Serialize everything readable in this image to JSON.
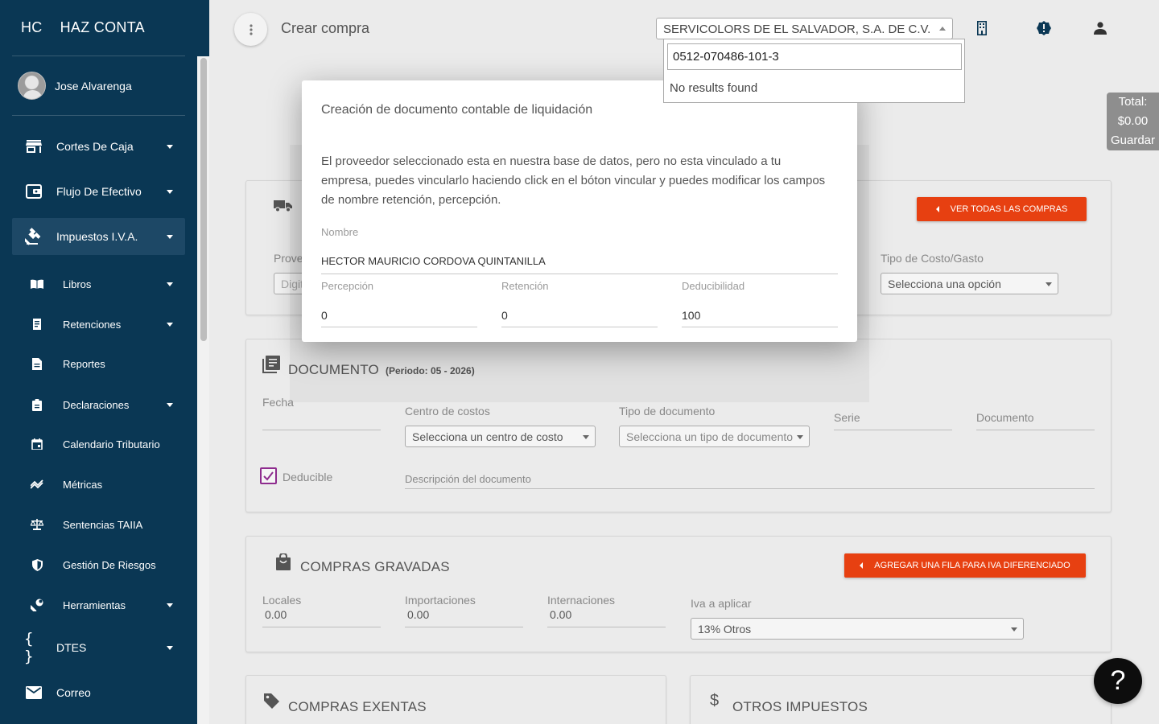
{
  "sidebar": {
    "brand_short": "HC",
    "brand_name": "HAZ CONTA",
    "user_name": "Jose Alvarenga",
    "items": [
      {
        "label": "Cortes De Caja",
        "icon": "store-icon"
      },
      {
        "label": "Flujo De Efectivo",
        "icon": "wallet-icon"
      },
      {
        "label": "Impuestos I.V.A.",
        "icon": "gavel-icon"
      },
      {
        "label": "Libros",
        "icon": "book-icon"
      },
      {
        "label": "Retenciones",
        "icon": "receipt-icon"
      },
      {
        "label": "Reportes",
        "icon": "report-icon"
      },
      {
        "label": "Declaraciones",
        "icon": "clipboard-icon"
      },
      {
        "label": "Calendario Tributario",
        "icon": "calendar-icon"
      },
      {
        "label": "Métricas",
        "icon": "chart-line-icon"
      },
      {
        "label": "Sentencias TAIIA",
        "icon": "scale-icon"
      },
      {
        "label": "Gestión De Riesgos",
        "icon": "shield-icon"
      },
      {
        "label": "Herramientas",
        "icon": "wrench-icon"
      },
      {
        "label": "DTES",
        "icon": "braces-icon"
      },
      {
        "label": "Correo",
        "icon": "mail-icon"
      }
    ]
  },
  "header": {
    "title": "Crear compra",
    "company": "SERVICOLORS DE EL SALVADOR, S.A. DE C.V.",
    "total_label": "Total:",
    "total_value": "$0.00",
    "save_label": "Guardar"
  },
  "dropdown": {
    "search_value": "0512-070486-101-3",
    "no_results": "No results found"
  },
  "provider_card": {
    "button": "VER TODAS LAS COMPRAS",
    "provider_label_partial": "Prove",
    "provider_placeholder_partial": "Digit",
    "cost_type_label": "Tipo de Costo/Gasto",
    "cost_type_value": "Selecciona una opción"
  },
  "document_card": {
    "title": "DOCUMENTO",
    "period": "(Periodo: 05 - 2026)",
    "fecha_label": "Fecha",
    "cost_center_label": "Centro de costos",
    "cost_center_value": "Selecciona un centro de costo",
    "doc_type_label": "Tipo de documento",
    "doc_type_value": "Selecciona un tipo de documento",
    "serie_label": "Serie",
    "documento_label": "Documento",
    "deducible_label": "Deducible",
    "description_label": "Descripción del documento"
  },
  "gravadas_card": {
    "title": "COMPRAS GRAVADAS",
    "button": "AGREGAR UNA FILA PARA IVA DIFERENCIADO",
    "locales_label": "Locales",
    "locales_value": "0.00",
    "importaciones_label": "Importaciones",
    "importaciones_value": "0.00",
    "internaciones_label": "Internaciones",
    "internaciones_value": "0.00",
    "iva_label": "Iva a aplicar",
    "iva_value": "13% Otros"
  },
  "exentas_card": {
    "title": "COMPRAS EXENTAS"
  },
  "otros_card": {
    "title": "OTROS IMPUESTOS"
  },
  "modal": {
    "title": "Creación de documento contable de liquidación",
    "description": "El proveedor seleccionado esta en nuestra base de datos, pero no esta vinculado a tu empresa, puedes vincularlo haciendo click en el bóton vincular y puedes modificar los campos de nombre retención, percepción.",
    "name_label": "Nombre",
    "name_value": "HECTOR MAURICIO CORDOVA QUINTANILLA",
    "percepcion_label": "Percepción",
    "percepcion_value": "0",
    "retencion_label": "Retención",
    "retencion_value": "0",
    "deducibilidad_label": "Deducibilidad",
    "deducibilidad_value": "100"
  },
  "help_label": "?",
  "colors": {
    "sidebar": "#0a3754",
    "accent": "#e74011",
    "checkbox": "#8e2c8e"
  }
}
